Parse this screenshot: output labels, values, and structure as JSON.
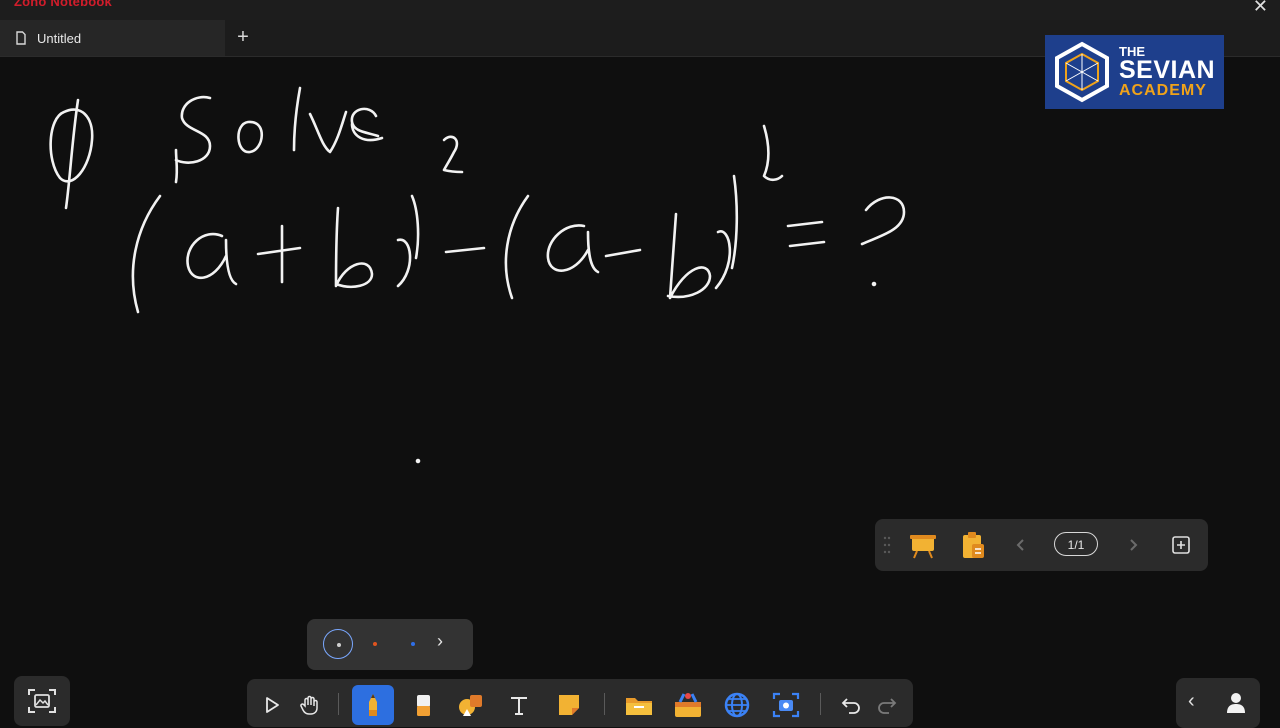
{
  "watermark": "Zoho Notebook",
  "window": {
    "close_label": "✕"
  },
  "tabs": [
    {
      "label": "Untitled",
      "icon": "document-icon"
    }
  ],
  "new_tab_label": "+",
  "logo": {
    "line1": "THE",
    "line2": "SEVIAN",
    "line3": "ACADEMY"
  },
  "board": {
    "handwriting": [
      "Q solve",
      "(a+b)² - (a-b)² = ?"
    ]
  },
  "page_panel": {
    "page_count": "1/1",
    "prev_icon": "chevron-left-icon",
    "next_icon": "chevron-right-icon"
  },
  "pen_colors": {
    "colors": [
      "#1a1a1a",
      "#e0541f",
      "#2f6fe8"
    ],
    "selected_index": 0,
    "more": "›"
  },
  "toolbar": {
    "tools": [
      "select-icon",
      "hand-icon",
      "pen-icon",
      "eraser-icon",
      "shapes-icon",
      "text-icon",
      "sticky-note-icon",
      "folder-icon",
      "toolbox-icon",
      "browser-icon",
      "screenshot-icon",
      "undo-icon",
      "redo-icon"
    ],
    "active_tool": "pen-icon"
  },
  "accent": "#2d6fe0",
  "right_corner": {
    "collapse": "‹"
  }
}
